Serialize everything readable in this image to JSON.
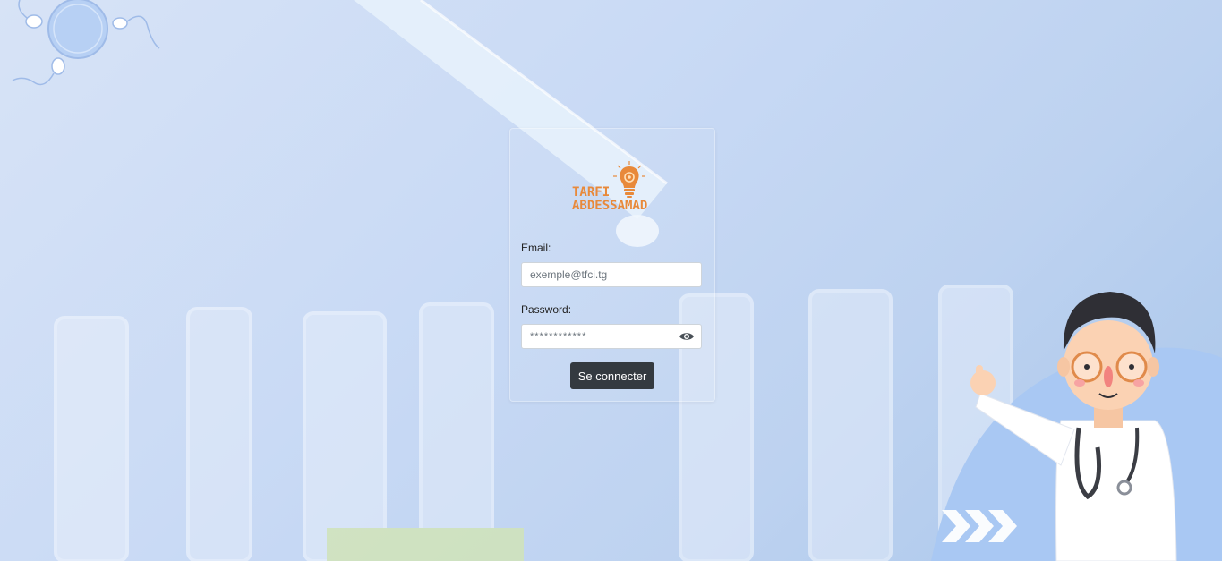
{
  "logo": {
    "line1": "TARFI",
    "line2": "ABDESSAMAD"
  },
  "form": {
    "email_label": "Email:",
    "email_placeholder": "exemple@tfci.tg",
    "password_label": "Password:",
    "password_placeholder": "************",
    "submit_label": "Se connecter"
  },
  "icons": {
    "eye": "eye-icon",
    "logo": "lightbulb-gear-icon",
    "mascot": "doctor-mascot",
    "corner": "sperm-egg-illustration"
  },
  "colors": {
    "accent": "#e8893a",
    "button": "#343a40",
    "background": "#c9daf5"
  }
}
